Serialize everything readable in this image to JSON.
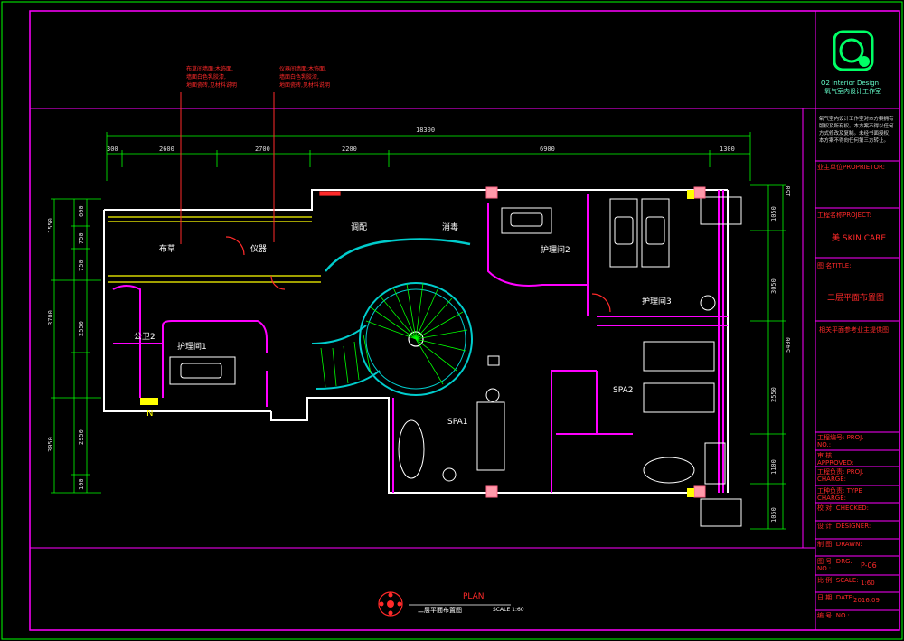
{
  "logo": {
    "mark": "O2",
    "company_en": "O2 Interior Design",
    "company_cn": "氧气室内设计工作室"
  },
  "copyright_text": "氧气室内设计工作室对本方案拥有版权及所有权。本方案不得以任何方式修改及复制。未经书面授权，本方案不得向任何第三方转让。",
  "title_block": {
    "proprietor_label": "业主单位PROPRIETOR:",
    "project_label": "工程名称PROJECT:",
    "project_value": "美 SKIN CARE",
    "title_label": "图 名TITLE:",
    "title_value": "二层平面布置图",
    "note_label": "相关平面参考业主提供图",
    "proj_no_label": "工程编号: PROJ. NO.:",
    "approved_label": "审 核: APPROVED:",
    "proj_charge_label": "工程负责: PROJ. CHARGE:",
    "type_charge_label": "工种负责: TYPE CHARGE:",
    "checked_label": "校 对: CHECKED:",
    "designer_label": "设 计: DESIGNER:",
    "drawn_label": "制 图: DRAWN:",
    "drg_no_label": "图 号: DRG. NO.:",
    "drg_no_value": "P-06",
    "scale_label": "比 例: SCALE:",
    "scale_value": "1:60",
    "date_label": "日 期: DATE:",
    "date_value": "2016.09",
    "no_label": "编 号: NO.:"
  },
  "plan": {
    "caption_en": "PLAN",
    "caption_cn": "二层平面布置图",
    "caption_scale": "SCALE 1:60",
    "north": "N",
    "rooms": {
      "bucao": "布草",
      "yiqi": "仪器",
      "tiaopei": "调配",
      "xiaodu": "消毒",
      "hulijian2": "护理间2",
      "hulijian3": "护理间3",
      "gongwei2": "公卫2",
      "hulijian1": "护理间1",
      "spa1": "SPA1",
      "spa2": "SPA2"
    },
    "notes": {
      "note1_line1": "布草间墙面:木饰面,",
      "note1_line2": "墙面白色乳胶漆,",
      "note1_line3": "地面瓷砖,见材料说明",
      "note2_line1": "仪器间墙面:木饰面,",
      "note2_line2": "墙面白色乳胶漆,",
      "note2_line3": "地面瓷砖,见材料说明"
    },
    "dims_top": {
      "total": "18300",
      "d1": "300",
      "d2": "2600",
      "d3": "2700",
      "d4": "2200",
      "d5": "6900",
      "d6": "1300"
    },
    "dims_left": {
      "l1": "1550",
      "l2": "600",
      "l3": "750",
      "l4": "750",
      "l5": "3700",
      "l6": "2550",
      "l7": "3050",
      "l8": "2950",
      "l9": "100"
    },
    "dims_right": {
      "r1": "150",
      "r2": "1050",
      "r3": "3050",
      "r4": "5400",
      "r5": "2550",
      "r6": "1100",
      "r7": "1050"
    }
  }
}
